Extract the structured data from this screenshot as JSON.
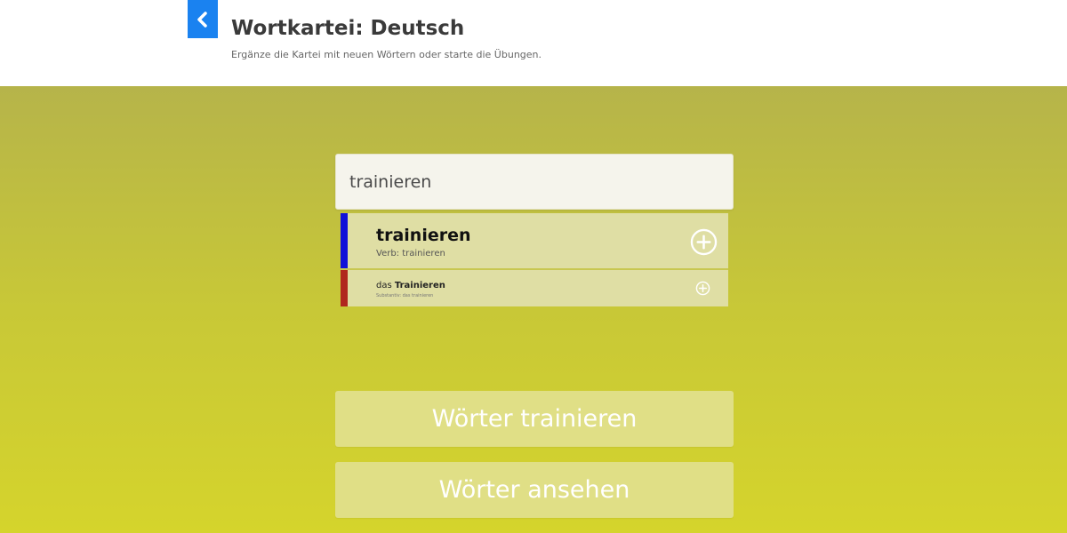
{
  "header": {
    "title": "Wortkartei: Deutsch",
    "subtitle": "Ergänze die Kartei mit neuen Wörtern oder starte die Übungen."
  },
  "search": {
    "value": "trainieren"
  },
  "suggestions": [
    {
      "word": "trainieren",
      "info": "Verb: trainieren",
      "color": "#1010d8",
      "icon": "add-circle-icon"
    },
    {
      "article": "das",
      "word": "Trainieren",
      "info": "Substantiv: das trainieren",
      "color": "#b0271e",
      "icon": "add-circle-icon"
    }
  ],
  "buttons": {
    "train_label": "Wörter trainieren",
    "view_label": "Wörter ansehen"
  },
  "colors": {
    "accent": "#1a82f0",
    "background_top": "#b6b44a",
    "background_bottom": "#d5d42c"
  }
}
